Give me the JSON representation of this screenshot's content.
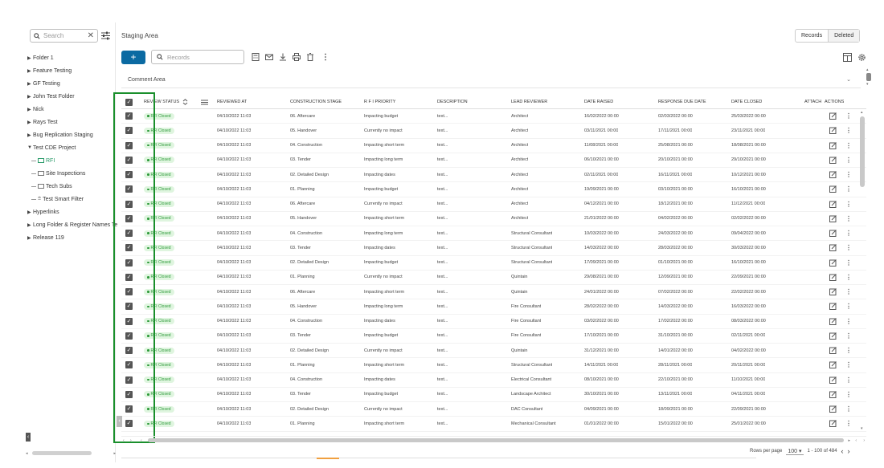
{
  "sidebar": {
    "search_placeholder": "Search",
    "close_glyph": "✕",
    "items": [
      {
        "label": "Folder 1",
        "type": "folder"
      },
      {
        "label": "Feature Testing",
        "type": "folder"
      },
      {
        "label": "GF Testing",
        "type": "folder"
      },
      {
        "label": "John Test Folder",
        "type": "folder"
      },
      {
        "label": "Nick",
        "type": "folder"
      },
      {
        "label": "Rays Test",
        "type": "folder"
      },
      {
        "label": "Bug Replication Staging",
        "type": "folder"
      },
      {
        "label": "Test CDE Project",
        "type": "open"
      },
      {
        "label": "RFI",
        "type": "register",
        "active": true
      },
      {
        "label": "Site Inspections",
        "type": "register"
      },
      {
        "label": "Tech Subs",
        "type": "register"
      },
      {
        "label": "Test Smart Filter",
        "type": "filter"
      },
      {
        "label": "Hyperlinks",
        "type": "folder"
      },
      {
        "label": "Long Folder & Register Names Te",
        "type": "folder"
      },
      {
        "label": "Release 119",
        "type": "folder"
      }
    ]
  },
  "header": {
    "title": "Staging Area",
    "toggle_records": "Records",
    "toggle_deleted": "Deleted",
    "add_label": "+",
    "records_placeholder": "Records",
    "comment_area": "Comment Area"
  },
  "grid": {
    "columns": [
      "REVIEW STATUS",
      "REVIEWED AT",
      "CONSTRUCTION STAGE",
      "R F I PRIORITY",
      "DESCRIPTION",
      "LEAD REVIEWER",
      "DATE RAISED",
      "RESPONSE DUE DATE",
      "DATE CLOSED",
      "ATTACH",
      "ACTIONS"
    ],
    "rows": [
      [
        "RFI Closed",
        "04/10/2022 11:03",
        "06. Aftercare",
        "Impacting budget",
        "text...",
        "Architect",
        "16/02/2022 00:00",
        "02/03/2022 00:00",
        "25/03/2022 00:00"
      ],
      [
        "RFI Closed",
        "04/10/2022 11:03",
        "05. Handover",
        "Currently no impact",
        "text...",
        "Architect",
        "03/11/2021 00:00",
        "17/11/2021 00:00",
        "23/11/2021 00:00"
      ],
      [
        "RFI Closed",
        "04/10/2022 11:03",
        "04. Construction",
        "Impacting short term",
        "text...",
        "Architect",
        "11/08/2021 00:00",
        "25/08/2021 00:00",
        "18/08/2021 00:00"
      ],
      [
        "RFI Closed",
        "04/10/2022 11:03",
        "03. Tender",
        "Impacting long term",
        "text...",
        "Architect",
        "06/10/2021 00:00",
        "20/10/2021 00:00",
        "29/10/2021 00:00"
      ],
      [
        "RFI Closed",
        "04/10/2022 11:03",
        "02. Detailed Design",
        "Impacting dates",
        "text...",
        "Architect",
        "02/11/2021 00:00",
        "16/11/2021 00:00",
        "10/12/2021 00:00"
      ],
      [
        "RFI Closed",
        "04/10/2022 11:03",
        "01. Planning",
        "Impacting budget",
        "text...",
        "Architect",
        "19/09/2021 00:00",
        "03/10/2021 00:00",
        "16/10/2021 00:00"
      ],
      [
        "RFI Closed",
        "04/10/2022 11:03",
        "06. Aftercare",
        "Currently no impact",
        "text...",
        "Architect",
        "04/12/2021 00:00",
        "18/12/2021 00:00",
        "11/12/2021 00:00"
      ],
      [
        "RFI Closed",
        "04/10/2022 11:03",
        "05. Handover",
        "Impacting short term",
        "text...",
        "Architect",
        "21/01/2022 00:00",
        "04/02/2022 00:00",
        "02/02/2022 00:00"
      ],
      [
        "RFI Closed",
        "04/10/2022 11:03",
        "04. Construction",
        "Impacting long term",
        "text...",
        "Structural Consultant",
        "10/03/2022 00:00",
        "24/03/2022 00:00",
        "09/04/2022 00:00"
      ],
      [
        "RFI Closed",
        "04/10/2022 11:03",
        "03. Tender",
        "Impacting dates",
        "text...",
        "Structural Consultant",
        "14/03/2022 00:00",
        "28/03/2022 00:00",
        "30/03/2022 00:00"
      ],
      [
        "RFI Closed",
        "04/10/2022 11:03",
        "02. Detailed Design",
        "Impacting budget",
        "text...",
        "Structural Consultant",
        "17/09/2021 00:00",
        "01/10/2021 00:00",
        "16/10/2021 00:00"
      ],
      [
        "RFI Closed",
        "04/10/2022 11:03",
        "01. Planning",
        "Currently no impact",
        "text...",
        "Quintain",
        "29/08/2021 00:00",
        "12/09/2021 00:00",
        "22/09/2021 00:00"
      ],
      [
        "RFI Closed",
        "04/10/2022 11:03",
        "06. Aftercare",
        "Impacting short term",
        "text...",
        "Quintain",
        "24/01/2022 00:00",
        "07/02/2022 00:00",
        "22/02/2022 00:00"
      ],
      [
        "RFI Closed",
        "04/10/2022 11:03",
        "05. Handover",
        "Impacting long term",
        "text...",
        "Fire Consultant",
        "28/02/2022 00:00",
        "14/03/2022 00:00",
        "16/03/2022 00:00"
      ],
      [
        "RFI Closed",
        "04/10/2022 11:03",
        "04. Construction",
        "Impacting dates",
        "text...",
        "Fire Consultant",
        "03/02/2022 00:00",
        "17/02/2022 00:00",
        "08/03/2022 00:00"
      ],
      [
        "RFI Closed",
        "04/10/2022 11:03",
        "03. Tender",
        "Impacting budget",
        "text...",
        "Fire Consultant",
        "17/10/2021 00:00",
        "31/10/2021 00:00",
        "02/11/2021 00:00"
      ],
      [
        "RFI Closed",
        "04/10/2022 11:03",
        "02. Detailed Design",
        "Currently no impact",
        "text...",
        "Quintain",
        "31/12/2021 00:00",
        "14/01/2022 00:00",
        "04/02/2022 00:00"
      ],
      [
        "RFI Closed",
        "04/10/2022 11:03",
        "01. Planning",
        "Impacting short term",
        "text...",
        "Structural Consultant",
        "14/11/2021 00:00",
        "28/11/2021 00:00",
        "20/11/2021 00:00"
      ],
      [
        "RFI Closed",
        "04/10/2022 11:03",
        "04. Construction",
        "Impacting dates",
        "text...",
        "Electrical Consultant",
        "08/10/2021 00:00",
        "22/10/2021 00:00",
        "11/10/2021 00:00"
      ],
      [
        "RFI Closed",
        "04/10/2022 11:03",
        "03. Tender",
        "Impacting budget",
        "text...",
        "Landscape Architect",
        "30/10/2021 00:00",
        "13/11/2021 00:00",
        "04/11/2021 00:00"
      ],
      [
        "RFI Closed",
        "04/10/2022 11:03",
        "02. Detailed Design",
        "Currently no impact",
        "text...",
        "DAC Consultant",
        "04/09/2021 00:00",
        "18/09/2021 00:00",
        "22/09/2021 00:00"
      ],
      [
        "RFI Closed",
        "04/10/2022 11:03",
        "01. Planning",
        "Impacting short term",
        "text...",
        "Mechanical Consultant",
        "01/01/2022 00:00",
        "15/01/2022 00:00",
        "25/01/2022 00:00"
      ]
    ]
  },
  "pager": {
    "rows_per_page_label": "Rows per page",
    "rows_per_page_value": "100",
    "range": "1 - 100 of 484"
  },
  "colors": {
    "primary": "#0b6aa2",
    "status_green": "#2e9a3a",
    "highlight": "#1a8f2c"
  }
}
